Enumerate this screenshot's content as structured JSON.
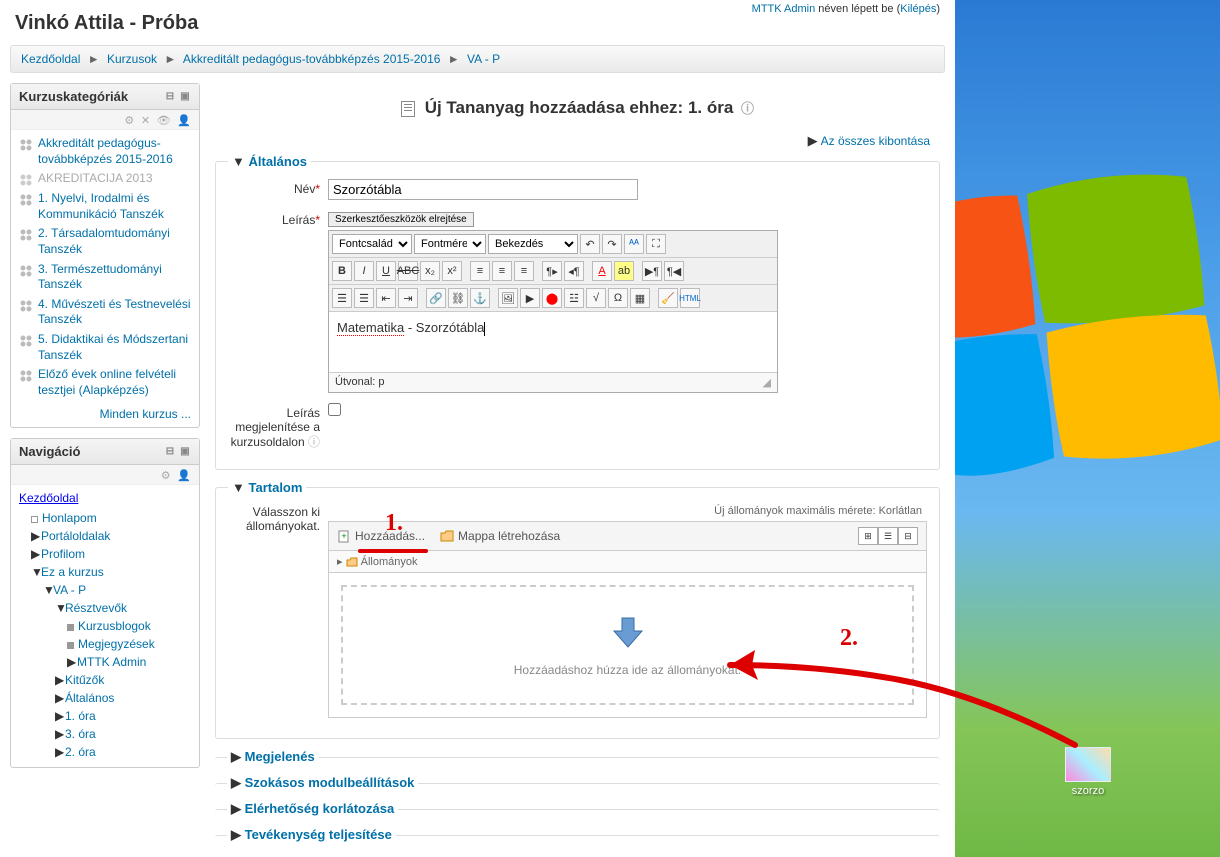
{
  "login": {
    "pre": "",
    "user": "MTTK Admin",
    "post": " néven lépett be (",
    "logout": "Kilépés",
    "close": ")"
  },
  "pageTitle": "Vinkó Attila - Próba",
  "breadcrumb": [
    "Kezdőoldal",
    "Kurzusok",
    "Akkreditált pedagógus-továbbképzés 2015-2016",
    "VA - P"
  ],
  "blocks": {
    "categories": {
      "title": "Kurzuskategóriák",
      "items": [
        {
          "label": "Akkreditált pedagógus-továbbképzés 2015-2016",
          "muted": false
        },
        {
          "label": "AKREDITACIJA 2013",
          "muted": true
        },
        {
          "label": "1. Nyelvi, Irodalmi és Kommunikáció Tanszék",
          "muted": false
        },
        {
          "label": "2. Társadalomtudományi Tanszék",
          "muted": false
        },
        {
          "label": "3. Természettudományi Tanszék",
          "muted": false
        },
        {
          "label": "4. Művészeti és Testnevelési Tanszék",
          "muted": false
        },
        {
          "label": "5. Didaktikai és Módszertani Tanszék",
          "muted": false
        },
        {
          "label": "Előző évek online felvételi tesztjei (Alapképzés)",
          "muted": false
        }
      ],
      "allCourses": "Minden kurzus ..."
    },
    "navigation": {
      "title": "Navigáció",
      "root": "Kezdőoldal",
      "items": [
        {
          "label": "Honlapom",
          "indent": 1,
          "bullet": "sq-hollow"
        },
        {
          "label": "Portáloldalak",
          "indent": 1,
          "tri": "▶"
        },
        {
          "label": "Profilom",
          "indent": 1,
          "tri": "▶"
        },
        {
          "label": "Ez a kurzus",
          "indent": 1,
          "tri": "▼"
        },
        {
          "label": "VA - P",
          "indent": 2,
          "tri": "▼"
        },
        {
          "label": "Résztvevők",
          "indent": 3,
          "tri": "▼"
        },
        {
          "label": "Kurzusblogok",
          "indent": 4,
          "bullet": "sq"
        },
        {
          "label": "Megjegyzések",
          "indent": 4,
          "bullet": "sq"
        },
        {
          "label": "MTTK Admin",
          "indent": 4,
          "tri": "▶"
        },
        {
          "label": "Kitűzők",
          "indent": 3,
          "tri": "▶"
        },
        {
          "label": "Általános",
          "indent": 3,
          "tri": "▶"
        },
        {
          "label": "1. óra",
          "indent": 3,
          "tri": "▶"
        },
        {
          "label": "3. óra",
          "indent": 3,
          "tri": "▶"
        },
        {
          "label": "2. óra",
          "indent": 3,
          "tri": "▶"
        }
      ]
    }
  },
  "contentHeader": "Új Tananyag hozzáadása ehhez: 1. óra",
  "expandAll": "Az összes kibontása",
  "fieldsets": {
    "general": "Általános",
    "content": "Tartalom",
    "appearance": "Megjelenés",
    "common": "Szokásos modulbeállítások",
    "restrict": "Elérhetőség korlátozása",
    "completion": "Tevékenység teljesítése"
  },
  "labels": {
    "name": "Név",
    "description": "Leírás",
    "displayDesc": "Leírás megjelenítése a kurzusoldalon",
    "chooseFiles": "Válasszon ki állományokat."
  },
  "form": {
    "nameValue": "Szorzótábla",
    "editorToggle": "Szerkesztőeszközök elrejtése",
    "editorSelects": [
      "Fontcsalád",
      "Fontméret",
      "Bekezdés"
    ],
    "descValue1": "Matematika",
    "descValue2": " - Szorzótábla",
    "path": "Útvonal: p"
  },
  "filePicker": {
    "maxSize": "Új állományok maximális mérete: Korlátlan",
    "add": "Hozzáadás...",
    "createFolder": "Mappa létrehozása",
    "pathLabel": "Állományok",
    "dropHint": "Hozzáadáshoz húzza ide az állományokat."
  },
  "annotations": {
    "one": "1.",
    "two": "2."
  },
  "desktop": {
    "iconLabel": "szorzo"
  }
}
